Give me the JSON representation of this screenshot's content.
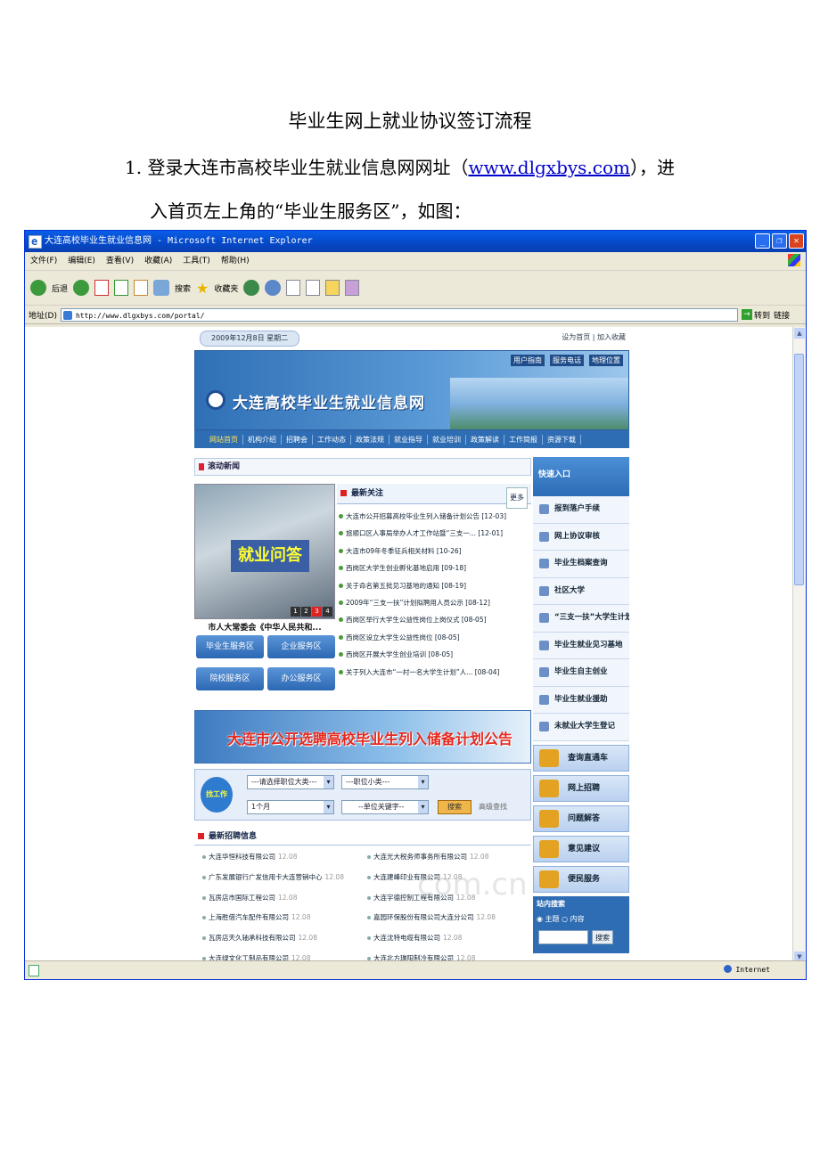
{
  "doc": {
    "title": "毕业生网上就业协议签订流程",
    "step1_num": "1.",
    "step1_a": "登录大连市高校毕业生就业信息网网址（",
    "step1_link": "www.dlgxbys.com",
    "step1_b": "），进",
    "step1_c": "入首页左上角的“毕业生服务区”，如图："
  },
  "browser": {
    "title": "大连高校毕业生就业信息网 - Microsoft Internet Explorer",
    "menus": [
      "文件(F)",
      "编辑(E)",
      "查看(V)",
      "收藏(A)",
      "工具(T)",
      "帮助(H)"
    ],
    "toolbar": {
      "back": "后退",
      "search": "搜索",
      "favorites": "收藏夹"
    },
    "address_label": "地址(D)",
    "address_value": "http://www.dlgxbys.com/portal/",
    "go": "转到",
    "links": "链接",
    "status_zone": "Internet"
  },
  "site": {
    "date": "2009年12月8日 星期二",
    "top_links": "设为首页 | 加入收藏",
    "banner_links": [
      "用户指南",
      "服务电话",
      "地理位置"
    ],
    "site_name": "大连高校毕业生就业信息网",
    "nav": [
      "网站首页",
      "机构介绍",
      "招聘会",
      "工作动态",
      "政策法规",
      "就业指导",
      "就业培训",
      "政策解读",
      "工作简报",
      "资源下载"
    ],
    "rolling_news": "滚动新闻",
    "photo_overlay": "就业问答",
    "photo_pager": [
      "1",
      "2",
      "3",
      "4"
    ],
    "photo_caption": "市人大常委会《中华人民共和...",
    "service_buttons": [
      "毕业生服务区",
      "企业服务区",
      "院校服务区",
      "办公服务区"
    ],
    "latest_title": "最新关注",
    "more": "更多",
    "latest": [
      "大连市公开招募高校毕业生列入储备计划公告 [12-03]",
      "旅顺口区人事局举办人才工作站暨“三支一... [12-01]",
      "大连市09年冬季征兵相关材料 [10-26]",
      "西岗区大学生创业孵化基地启用 [09-18]",
      "关于命名第五批见习基地的通知 [08-19]",
      "2009年“三支一扶”计划拟聘用人员公示 [08-12]",
      "西岗区举行大学生公益性岗位上岗仪式 [08-05]",
      "西岗区设立大学生公益性岗位 [08-05]",
      "西岗区开展大学生创业培训 [08-05]",
      "关于列入大连市“一村一名大学生计划”人... [08-04]"
    ],
    "ad_text": "大连市公开选聘高校毕业生列入储备计划公告",
    "find_job": {
      "badge": "找工作",
      "cat_big": "---请选择职位大类---",
      "cat_small": "---职位小类---",
      "period": "1个月",
      "keyword": "--单位关键字--",
      "search": "搜索",
      "advanced": "高级查找"
    },
    "recruit_title": "最新招聘信息",
    "recruit": [
      [
        "大连华恒科技有限公司",
        "12.08",
        "大连光大税务师事务所有限公司",
        "12.08"
      ],
      [
        "广东发展银行广发信用卡大连营销中心",
        "12.08",
        "大连建峰印业有限公司",
        "12.08"
      ],
      [
        "瓦房店市国际工程公司",
        "12.08",
        "大连宇德控制工程有限公司",
        "12.08"
      ],
      [
        "上海胜借汽车配件有限公司",
        "12.08",
        "嘉园环保股份有限公司大连分公司",
        "12.08"
      ],
      [
        "瓦房店天久轴承科技有限公司",
        "12.08",
        "大连沈特电缆有限公司",
        "12.08"
      ],
      [
        "大连绿文化工制品有限公司",
        "12.08",
        "大连北方瑞阳制冷有限公司",
        "12.08"
      ]
    ],
    "quick_title": "快速入口",
    "quick_items": [
      "报到落户手续",
      "网上协议审核",
      "毕业生档案查询",
      "社区大学",
      "“三支一扶”大学生计划",
      "毕业生就业见习基地",
      "毕业生自主创业",
      "毕业生就业援助",
      "未就业大学生登记"
    ],
    "quick_big": [
      "查询直通车",
      "网上招聘",
      "问题解答",
      "意见建议",
      "便民服务"
    ],
    "site_search": {
      "title": "站内搜索",
      "opt1": "主题",
      "opt2": "内容",
      "button": "搜索"
    }
  },
  "watermark": "com.cn"
}
